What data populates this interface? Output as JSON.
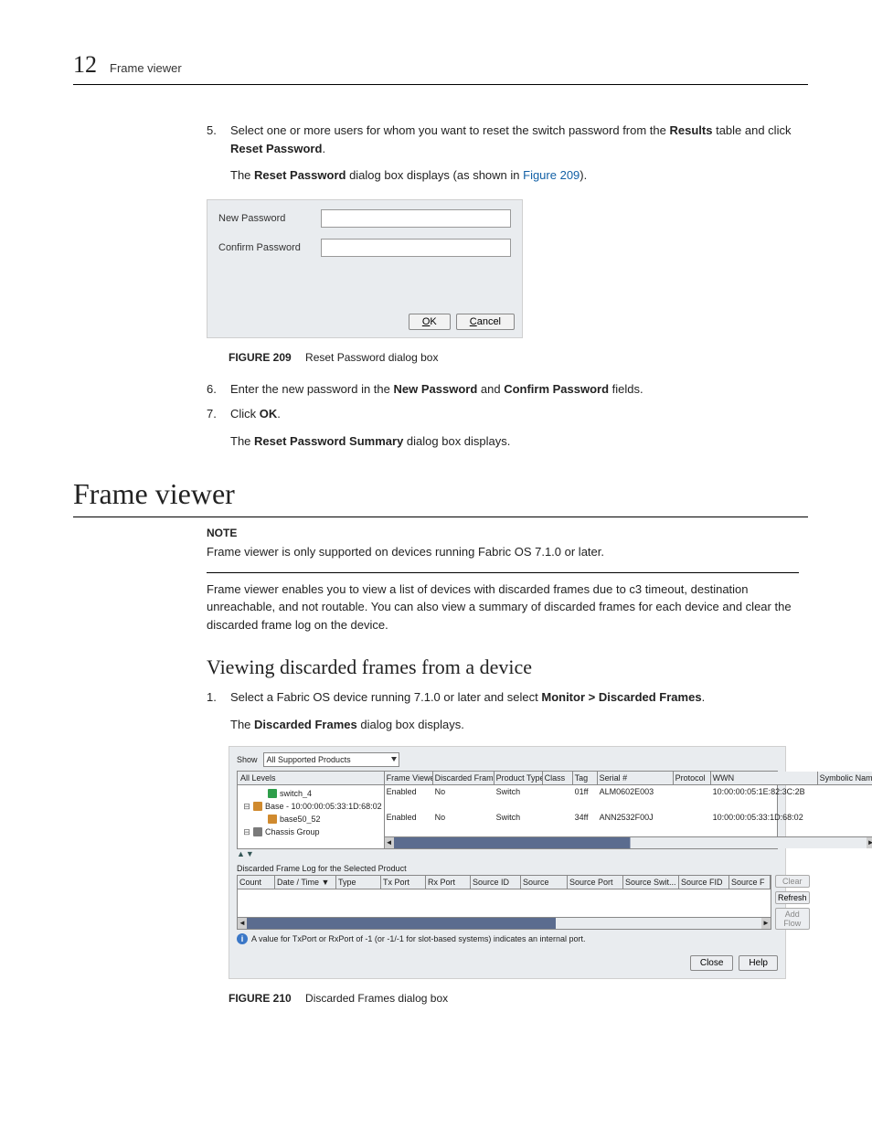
{
  "header": {
    "chapter_number": "12",
    "chapter_title": "Frame viewer"
  },
  "steps_top": {
    "s5": {
      "num": "5.",
      "text_pre": "Select one or more users for whom you want to reset the switch password from the ",
      "results": "Results",
      "mid": " table and click ",
      "reset_pw": "Reset Password",
      "suffix": ".",
      "sub_pre": "The ",
      "sub_bold": "Reset Password",
      "sub_post": " dialog box displays (as shown in ",
      "sub_link": "Figure 209",
      "sub_end": ")."
    },
    "s6": {
      "num": "6.",
      "pre": "Enter the new password in the ",
      "np": "New Password",
      "mid": " and ",
      "cp": "Confirm Password",
      "post": " fields."
    },
    "s7": {
      "num": "7.",
      "pre": "Click ",
      "ok": "OK",
      "post": ".",
      "sub_pre": "The ",
      "sub_bold": "Reset Password Summary",
      "sub_post": " dialog box displays."
    }
  },
  "reset_dialog": {
    "field1_label": "New Password",
    "field2_label": "Confirm Password",
    "ok": "OK",
    "cancel": "Cancel"
  },
  "figure209": {
    "label": "FIGURE 209",
    "caption": "Reset Password dialog box"
  },
  "h1": "Frame viewer",
  "note": {
    "label": "NOTE",
    "text": "Frame viewer is only supported on devices running Fabric OS 7.1.0 or later."
  },
  "intro_para": "Frame viewer enables you to view a list of devices with discarded frames due to c3 timeout, destination unreachable, and not routable. You can also view a summary of discarded frames for each device and clear the discarded frame log on the device.",
  "h2": "Viewing discarded frames from a device",
  "steps_bottom": {
    "s1": {
      "num": "1.",
      "pre": "Select a Fabric OS device running 7.1.0 or later and select ",
      "menu": "Monitor > Discarded Frames",
      "post": ".",
      "sub_pre": "The ",
      "sub_bold": "Discarded Frames",
      "sub_post": " dialog box displays."
    }
  },
  "dfdialog": {
    "show_label": "Show",
    "show_value": "All Supported Products",
    "tree_header": "All Levels",
    "tree_rows": [
      {
        "indent": 1,
        "icon": "sw",
        "text": "switch_4"
      },
      {
        "indent": 0,
        "twisty": "⊟",
        "icon": "host",
        "text": "Base - 10:00:00:05:33:1D:68:02"
      },
      {
        "indent": 1,
        "icon": "host",
        "text": "base50_52"
      },
      {
        "indent": 0,
        "twisty": "⊟",
        "icon": "grp",
        "text": "Chassis Group"
      }
    ],
    "upper_headers": [
      "Frame Viewer",
      "Discarded Frames",
      "Product Type",
      "Class",
      "Tag",
      "Serial #",
      "Protocol",
      "WWN",
      "Symbolic Nam"
    ],
    "col_widths": [
      "48px",
      "62px",
      "48px",
      "28px",
      "22px",
      "78px",
      "36px",
      "112px",
      "58px"
    ],
    "upper_rows": [
      {
        "cells": [
          "Enabled",
          "No",
          "Switch",
          "",
          "01ff",
          "ALM0602E003",
          "",
          "10:00:00:05:1E:82:3C:2B",
          ""
        ]
      },
      {
        "cells": [
          "",
          "",
          "",
          "",
          "",
          "",
          "",
          "",
          ""
        ]
      },
      {
        "cells": [
          "Enabled",
          "No",
          "Switch",
          "",
          "34ff",
          "ANN2532F00J",
          "",
          "10:00:00:05:33:1D:68:02",
          ""
        ]
      },
      {
        "cells": [
          "",
          "",
          "",
          "",
          "",
          "",
          "",
          "",
          ""
        ]
      }
    ],
    "sub_label": "Discarded Frame Log for the Selected Product",
    "lower_headers": [
      "Count",
      "Date / Time ▼",
      "Type",
      "Tx Port",
      "Rx Port",
      "Source ID",
      "Source",
      "Source Port",
      "Source Swit...",
      "Source FID",
      "Source F"
    ],
    "lower_widths": [
      "36px",
      "62px",
      "44px",
      "44px",
      "44px",
      "50px",
      "46px",
      "56px",
      "56px",
      "50px",
      "40px"
    ],
    "side_buttons": {
      "clear": "Clear",
      "refresh": "Refresh",
      "addflow": "Add Flow"
    },
    "info_text": "A value for TxPort or RxPort of -1 (or -1/-1 for slot-based systems) indicates an internal port.",
    "close": "Close",
    "help": "Help"
  },
  "figure210": {
    "label": "FIGURE 210",
    "caption": "Discarded Frames dialog box"
  }
}
